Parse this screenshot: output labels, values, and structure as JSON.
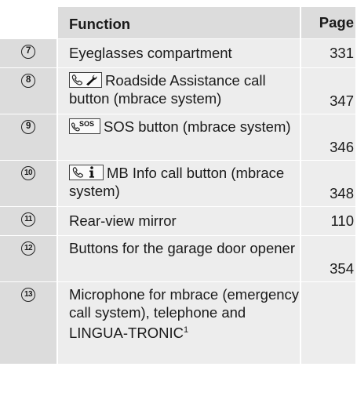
{
  "header": {
    "function": "Function",
    "page": "Page"
  },
  "rows": [
    {
      "num": "7",
      "text": "Eyeglasses compartment",
      "page": "331"
    },
    {
      "num": "8",
      "icon": "phone-wrench-icon",
      "text": "Roadside Assistance call button (mbrace system)",
      "page": "347"
    },
    {
      "num": "9",
      "icon": "phone-sos-icon",
      "icon_text": "SOS",
      "text": "SOS button (mbrace system)",
      "page": "346"
    },
    {
      "num": "10",
      "icon": "phone-info-icon",
      "text": "MB Info call button (mbrace system)",
      "page": "348"
    },
    {
      "num": "11",
      "text": "Rear-view mirror",
      "page": "110"
    },
    {
      "num": "12",
      "text": "Buttons for the garage door opener",
      "page": "354"
    },
    {
      "num": "13",
      "text": "Microphone for mbrace (emergency call system), telephone and LINGUA-TRONIC",
      "footnote": "1",
      "page": ""
    }
  ]
}
